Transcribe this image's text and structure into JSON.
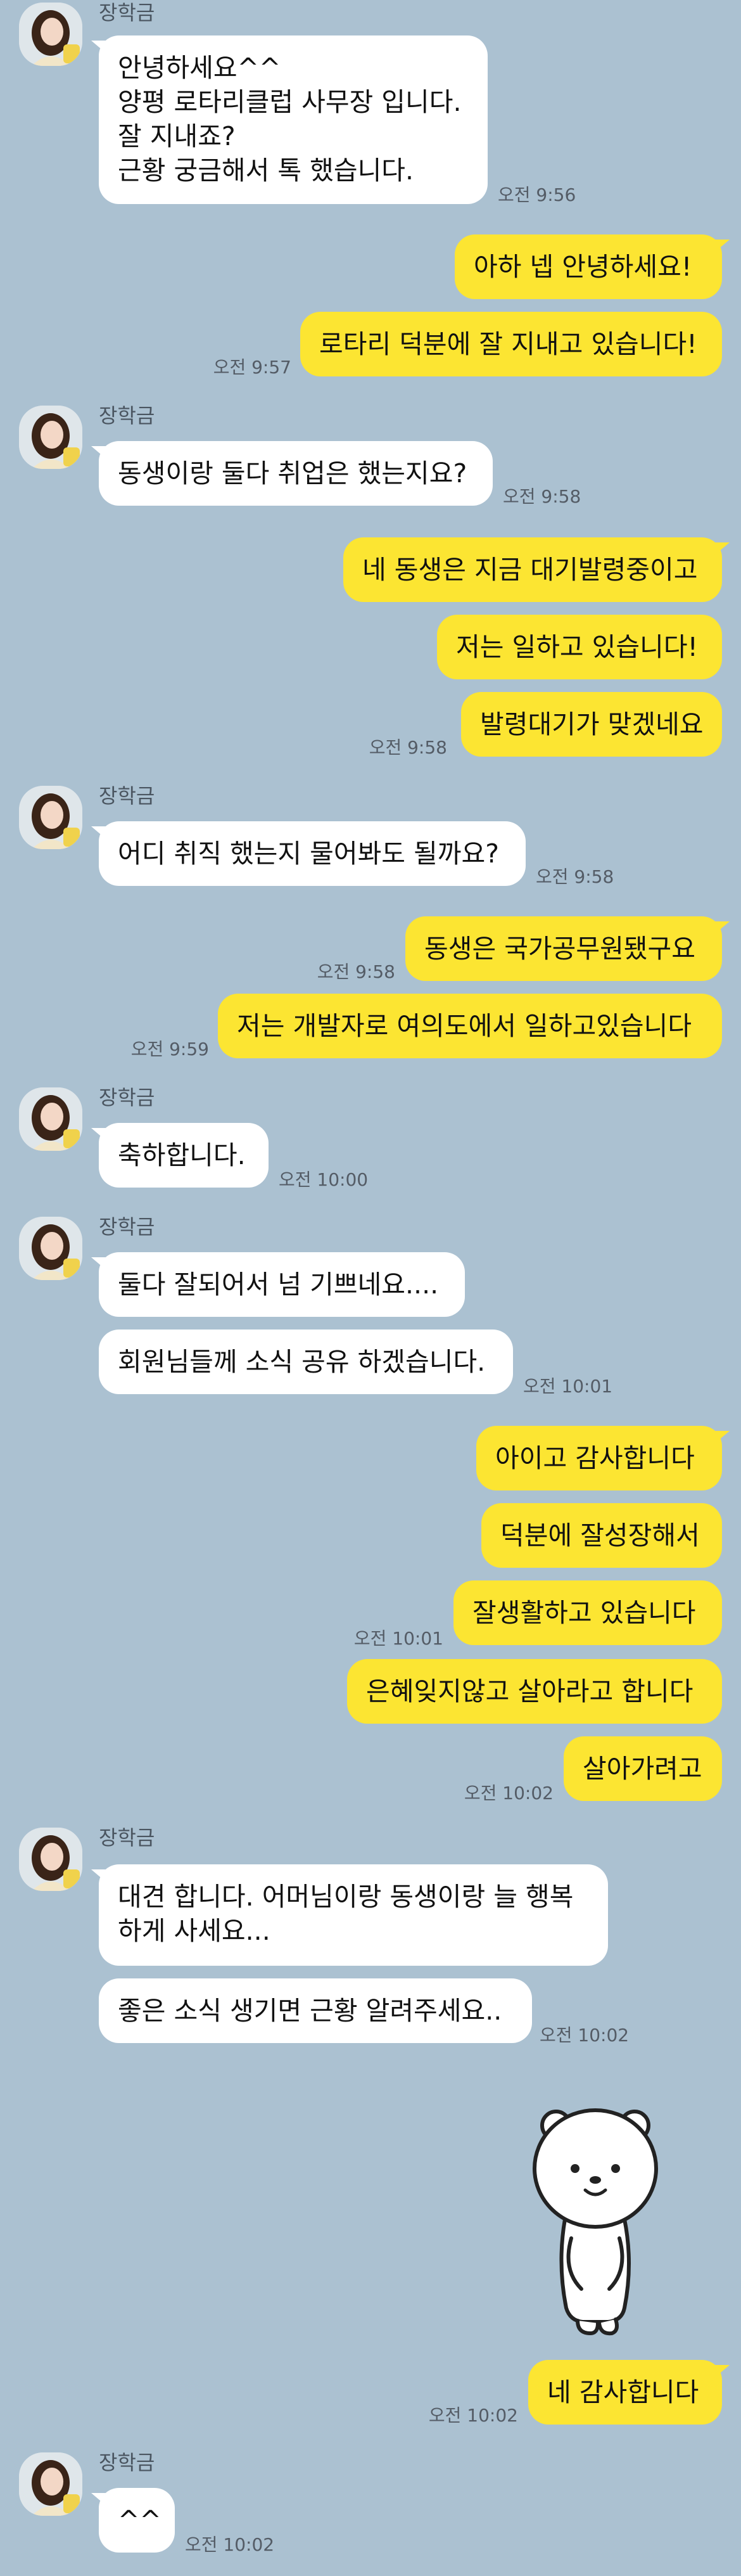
{
  "chat": {
    "sender_name": "장학금",
    "messages": [
      {
        "label_lines": [
          "안녕하세요^^",
          "양평 로타리클럽 사무장 입니다.",
          "잘 지내죠?",
          "근황 궁금해서 톡 했습니다."
        ],
        "time": "오전 9:56"
      },
      {
        "text": "아하 넵 안녕하세요!"
      },
      {
        "text": "로타리 덕분에 잘 지내고 있습니다!",
        "time": "오전 9:57"
      },
      {
        "text": "동생이랑 둘다 취업은 했는지요?",
        "time": "오전 9:58"
      },
      {
        "text": "네 동생은 지금 대기발령중이고"
      },
      {
        "text": "저는 일하고 있습니다!"
      },
      {
        "text": "발령대기가 맞겠네요",
        "time": "오전 9:58"
      },
      {
        "text": "어디 취직 했는지 물어봐도 될까요?",
        "time": "오전 9:58"
      },
      {
        "text": "동생은 국가공무원됐구요",
        "time": "오전 9:58"
      },
      {
        "text": "저는 개발자로 여의도에서 일하고있습니다",
        "time": "오전 9:59"
      },
      {
        "text": "축하합니다.",
        "time": "오전 10:00"
      },
      {
        "text": "둘다 잘되어서 넘 기쁘네요...."
      },
      {
        "text": "회원님들께 소식 공유 하겠습니다.",
        "time": "오전 10:01"
      },
      {
        "text": "아이고 감사합니다"
      },
      {
        "text": "덕분에 잘성장해서"
      },
      {
        "text": "잘생활하고 있습니다",
        "time": "오전 10:01"
      },
      {
        "text": "은혜잊지않고 살아라고 합니다"
      },
      {
        "text": "살아가려고",
        "time": "오전 10:02"
      },
      {
        "label_lines": [
          "대견 합니다.  어머님이랑 동생이랑 늘 행복",
          "하게 사세요..."
        ]
      },
      {
        "text": "좋은 소식 생기면 근황 알려주세요..",
        "time": "오전 10:02"
      },
      {
        "text": "네 감사합니다",
        "time": "오전 10:02"
      },
      {
        "text": "^^",
        "time": "오전 10:02"
      }
    ],
    "icons": {
      "avatar": "profile-photo",
      "sticker": "bear-sticker"
    }
  }
}
